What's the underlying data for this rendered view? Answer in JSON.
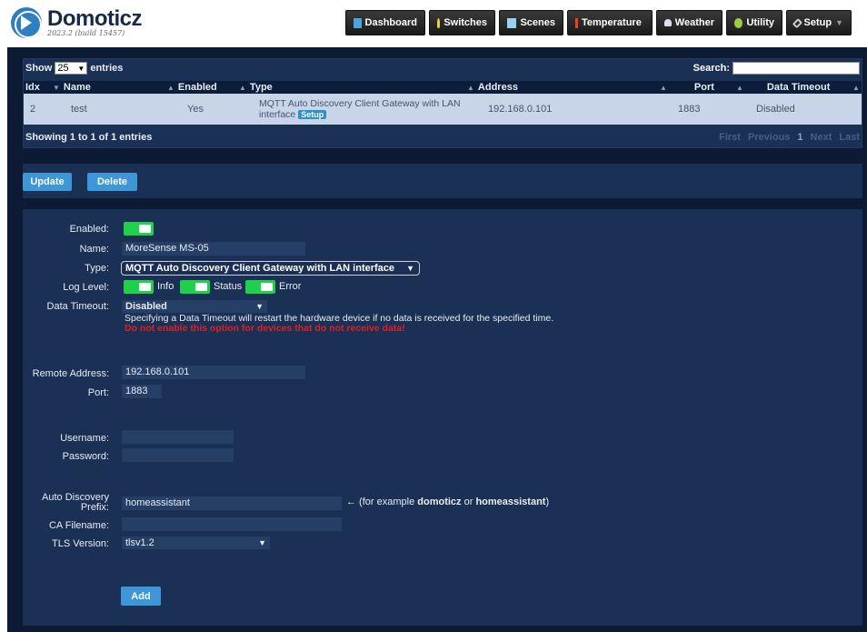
{
  "app": {
    "title": "Domoticz",
    "version": "2023.2 (build 15457)"
  },
  "nav": [
    {
      "label": "Dashboard",
      "icon": "dashboard-icon"
    },
    {
      "label": "Switches",
      "icon": "bulb-icon"
    },
    {
      "label": "Scenes",
      "icon": "scene-icon"
    },
    {
      "label": "Temperature",
      "icon": "thermometer-icon"
    },
    {
      "label": "Weather",
      "icon": "cloud-icon"
    },
    {
      "label": "Utility",
      "icon": "utility-icon"
    },
    {
      "label": "Setup",
      "icon": "wrench-icon"
    }
  ],
  "table": {
    "show_label": "Show",
    "entries_value": "25",
    "entries_label": "entries",
    "search_label": "Search:",
    "columns": [
      "Idx",
      "Name",
      "Enabled",
      "Type",
      "Address",
      "Port",
      "Data Timeout"
    ],
    "rows": [
      {
        "idx": "2",
        "name": "test",
        "enabled": "Yes",
        "type": "MQTT Auto Discovery Client Gateway with LAN interface",
        "setup": "Setup",
        "address": "192.168.0.101",
        "port": "1883",
        "timeout": "Disabled"
      }
    ],
    "showing": "Showing 1 to 1 of 1 entries",
    "pager": {
      "first": "First",
      "previous": "Previous",
      "current": "1",
      "next": "Next",
      "last": "Last"
    }
  },
  "actions": {
    "update": "Update",
    "delete": "Delete"
  },
  "form": {
    "enabled_label": "Enabled:",
    "name_label": "Name:",
    "name_value": "MoreSense MS-05",
    "type_label": "Type:",
    "type_value": "MQTT Auto Discovery Client Gateway with LAN interface",
    "log_level_label": "Log Level:",
    "log_info": "Info",
    "log_status": "Status",
    "log_error": "Error",
    "data_timeout_label": "Data Timeout:",
    "data_timeout_value": "Disabled",
    "timeout_note": "Specifying a Data Timeout will restart the hardware device if no data is received for the specified time.",
    "timeout_warning": "Do not enable this option for devices that do not receive data!",
    "remote_address_label": "Remote Address:",
    "remote_address_value": "192.168.0.101",
    "port_label": "Port:",
    "port_value": "1883",
    "username_label": "Username:",
    "password_label": "Password:",
    "prefix_label_1": "Auto Discovery",
    "prefix_label_2": "Prefix:",
    "prefix_value": "homeassistant",
    "prefix_hint_pre": "← (for example ",
    "prefix_hint_b1": "domoticz",
    "prefix_hint_or": " or ",
    "prefix_hint_b2": "homeassistant",
    "prefix_hint_post": ")",
    "ca_label": "CA Filename:",
    "tls_label": "TLS Version:",
    "tls_value": "tlsv1.2",
    "add_label": "Add"
  }
}
